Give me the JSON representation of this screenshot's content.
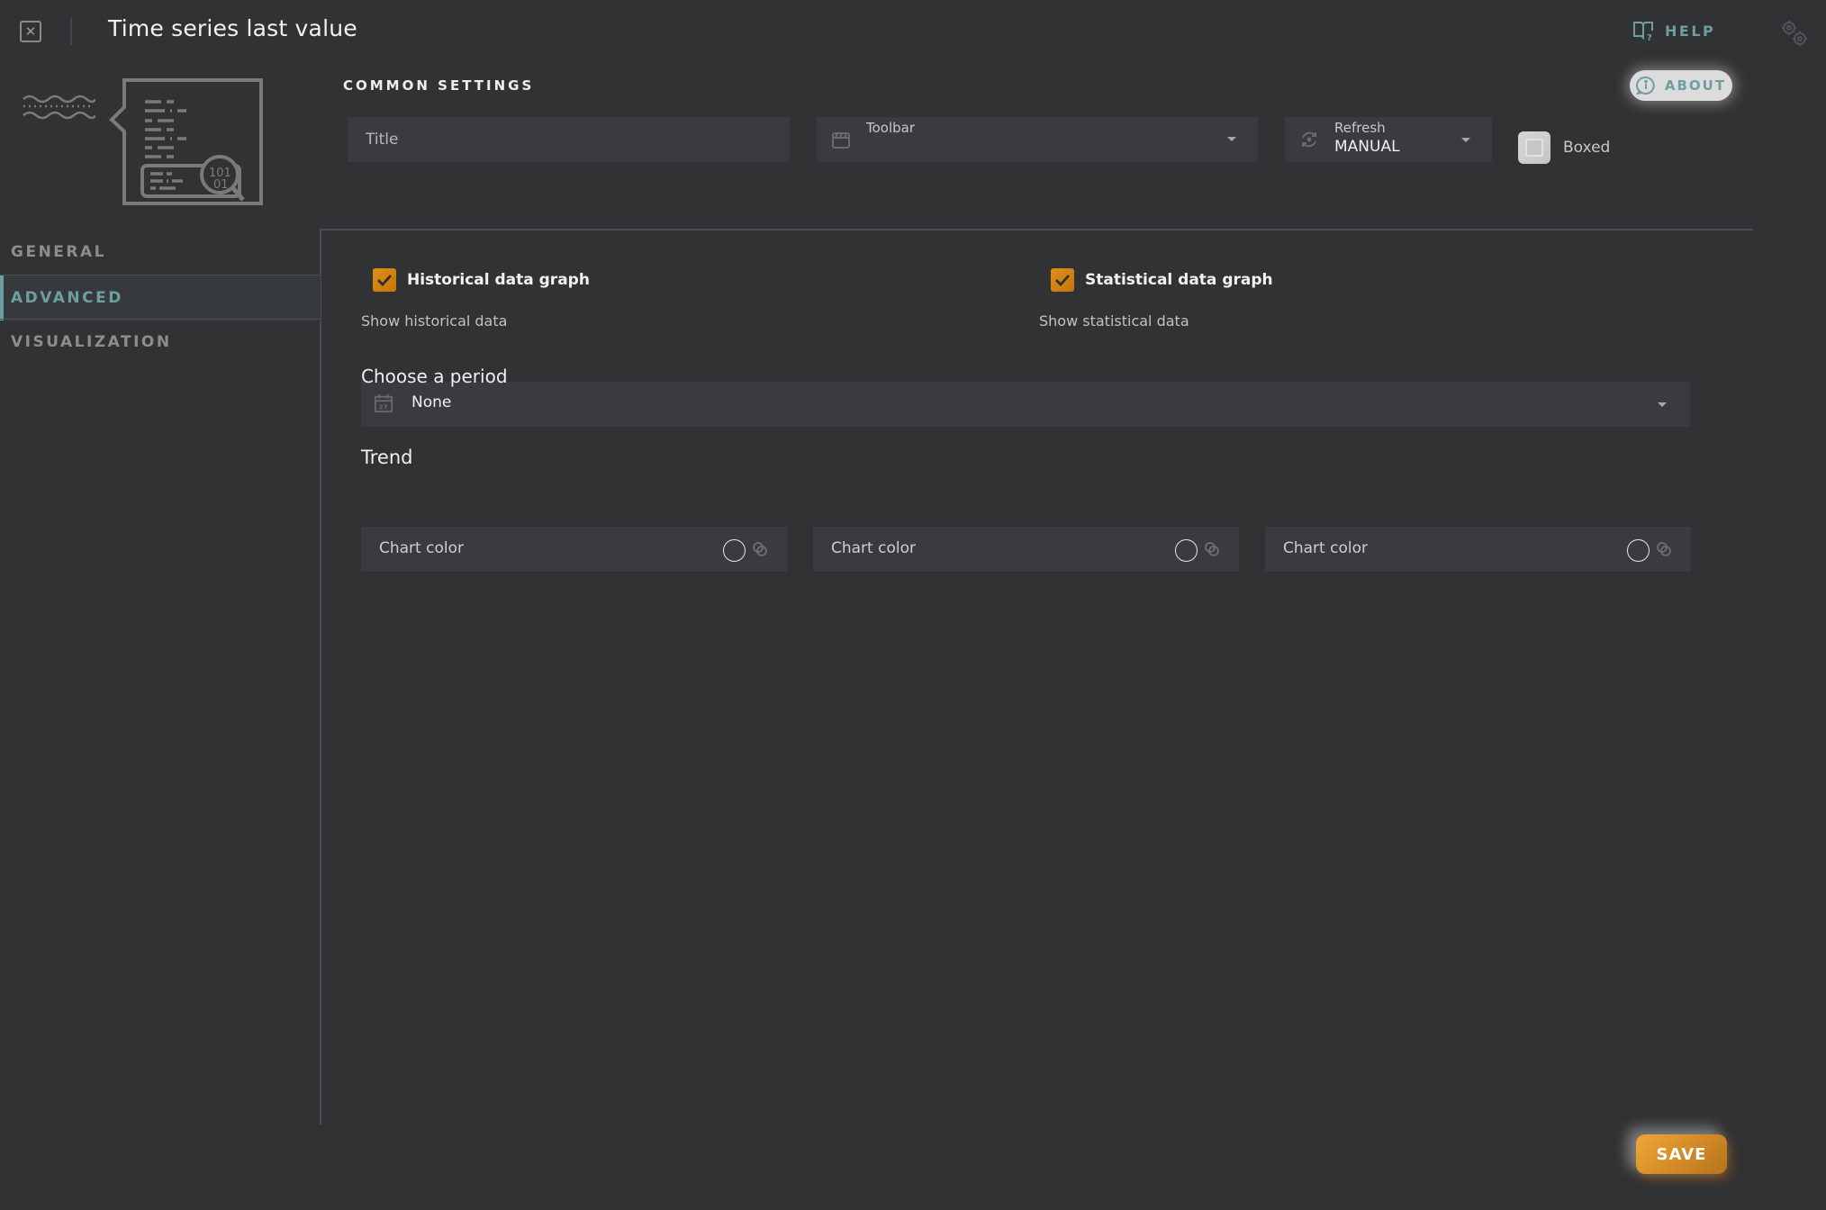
{
  "header": {
    "title": "Time series last value",
    "help_label": "HELP",
    "close_icon": "close-x-icon",
    "help_icon": "book-question-icon",
    "settings_icon": "gears-icon"
  },
  "common_settings": {
    "heading": "COMMON SETTINGS",
    "about_label": "ABOUT",
    "title_field": {
      "placeholder": "Title",
      "value": ""
    },
    "toolbar_field": {
      "label": "Toolbar",
      "value": ""
    },
    "refresh_field": {
      "label": "Refresh",
      "value": "MANUAL"
    },
    "boxed": {
      "label": "Boxed",
      "checked": false
    }
  },
  "sidebar": {
    "items": [
      {
        "label": "GENERAL",
        "active": false
      },
      {
        "label": "ADVANCED",
        "active": true
      },
      {
        "label": "VISUALIZATION",
        "active": false
      }
    ]
  },
  "advanced": {
    "historical": {
      "label": "Historical data graph",
      "checked": true,
      "description": "Show historical data"
    },
    "statistical": {
      "label": "Statistical data graph",
      "checked": true,
      "description": "Show statistical data"
    },
    "period": {
      "label": "Choose a period",
      "value": "None"
    },
    "trend": {
      "label": "Trend",
      "colors": [
        {
          "label": "Chart color"
        },
        {
          "label": "Chart color"
        },
        {
          "label": "Chart color"
        }
      ]
    }
  },
  "footer": {
    "save_label": "SAVE"
  },
  "colors": {
    "accent": "#6f9ea0",
    "primary": "#e0901a",
    "background": "#313234"
  }
}
